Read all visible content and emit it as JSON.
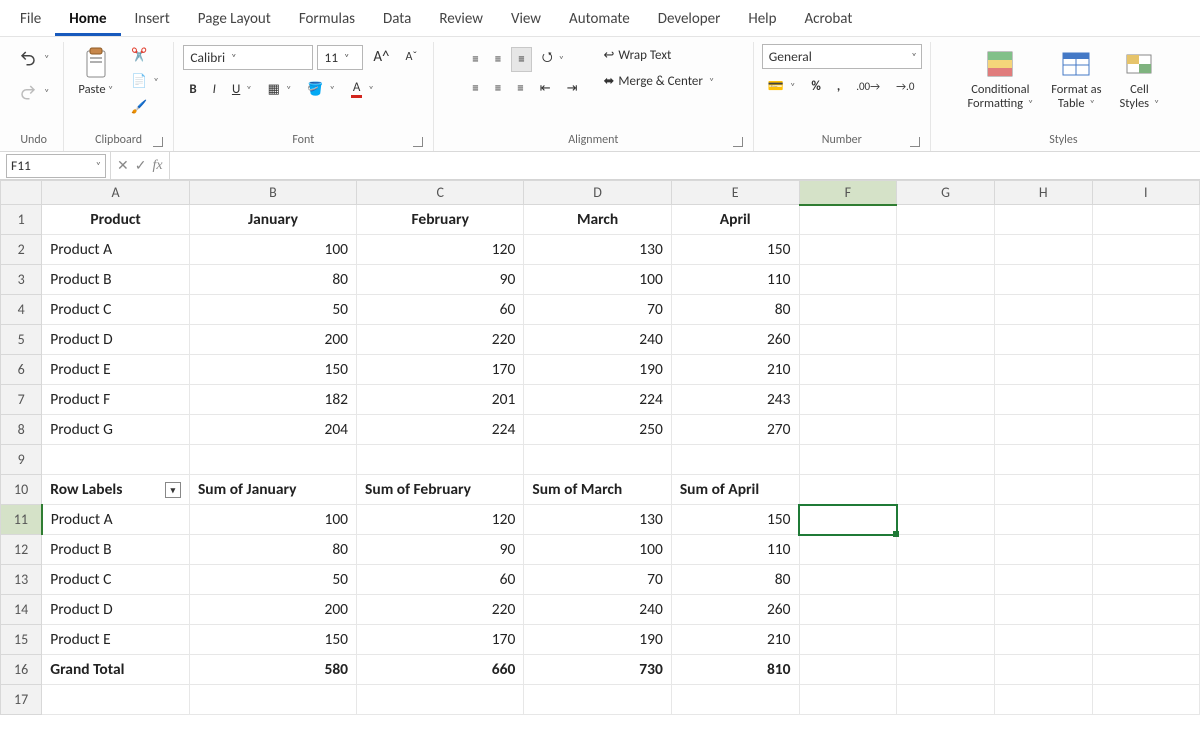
{
  "menu": {
    "items": [
      "File",
      "Home",
      "Insert",
      "Page Layout",
      "Formulas",
      "Data",
      "Review",
      "View",
      "Automate",
      "Developer",
      "Help",
      "Acrobat"
    ],
    "active": 1
  },
  "ribbon": {
    "undo_label": "Undo",
    "clipboard_label": "Clipboard",
    "paste_label": "Paste",
    "font_label": "Font",
    "font_name": "Calibri",
    "font_size": "11",
    "alignment_label": "Alignment",
    "wrap_text": "Wrap Text",
    "merge_center": "Merge & Center",
    "number_label": "Number",
    "number_format": "General",
    "styles_label": "Styles",
    "cond_fmt_l1": "Conditional",
    "cond_fmt_l2": "Formatting",
    "fmt_table_l1": "Format as",
    "fmt_table_l2": "Table",
    "cell_styles_l1": "Cell",
    "cell_styles_l2": "Styles"
  },
  "formula_bar": {
    "name_box": "F11",
    "formula": ""
  },
  "columns": [
    "A",
    "B",
    "C",
    "D",
    "E",
    "F",
    "G",
    "H",
    "I"
  ],
  "row_numbers": [
    1,
    2,
    3,
    4,
    5,
    6,
    7,
    8,
    9,
    10,
    11,
    12,
    13,
    14,
    15,
    16,
    17
  ],
  "table": {
    "headers": [
      "Product",
      "January",
      "February",
      "March",
      "April"
    ],
    "rows": [
      {
        "p": "Product A",
        "v": [
          100,
          120,
          130,
          150
        ]
      },
      {
        "p": "Product B",
        "v": [
          80,
          90,
          100,
          110
        ]
      },
      {
        "p": "Product C",
        "v": [
          50,
          60,
          70,
          80
        ]
      },
      {
        "p": "Product D",
        "v": [
          200,
          220,
          240,
          260
        ]
      },
      {
        "p": "Product E",
        "v": [
          150,
          170,
          190,
          210
        ]
      },
      {
        "p": "Product F",
        "v": [
          182,
          201,
          224,
          243
        ]
      },
      {
        "p": "Product G",
        "v": [
          204,
          224,
          250,
          270
        ]
      }
    ]
  },
  "pivot": {
    "headers": [
      "Row Labels",
      "Sum of January",
      "Sum of February",
      "Sum of March",
      "Sum of April"
    ],
    "rows": [
      {
        "p": "Product A",
        "v": [
          100,
          120,
          130,
          150
        ]
      },
      {
        "p": "Product B",
        "v": [
          80,
          90,
          100,
          110
        ]
      },
      {
        "p": "Product C",
        "v": [
          50,
          60,
          70,
          80
        ]
      },
      {
        "p": "Product D",
        "v": [
          200,
          220,
          240,
          260
        ]
      },
      {
        "p": "Product E",
        "v": [
          150,
          170,
          190,
          210
        ]
      }
    ],
    "grand_total_label": "Grand Total",
    "grand_total": [
      580,
      660,
      730,
      810
    ]
  },
  "selection": {
    "col": "F",
    "row": 11
  }
}
